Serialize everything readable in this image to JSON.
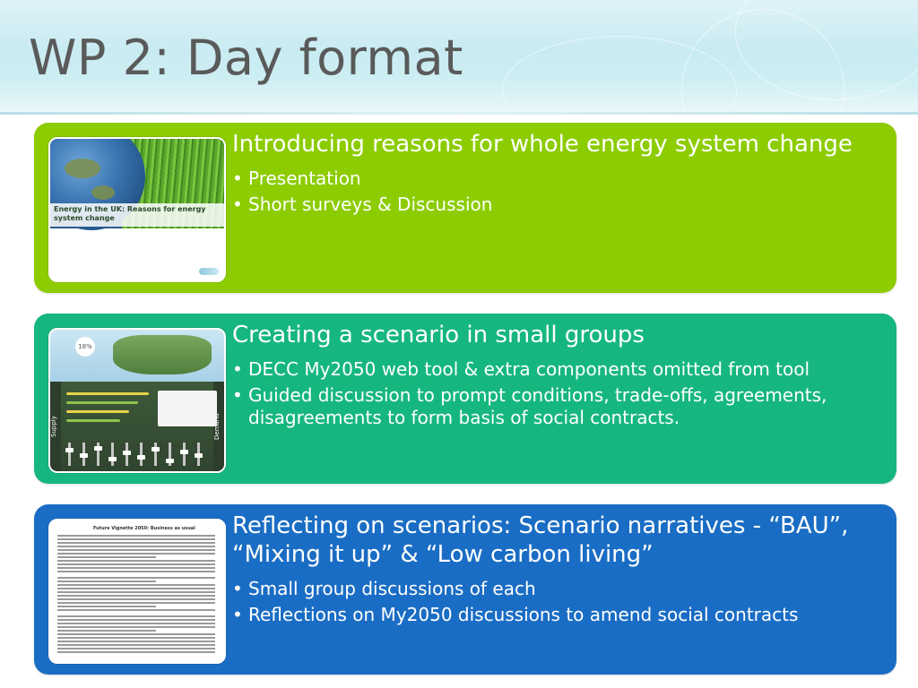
{
  "slide": {
    "title": "WP 2: Day format"
  },
  "panels": [
    {
      "heading": "Introducing reasons for whole energy system change",
      "bullets": [
        "Presentation",
        "Short surveys & Discussion"
      ],
      "thumbnail": {
        "caption": "Energy in the UK: Reasons for energy system change"
      },
      "color": "#8ccc00"
    },
    {
      "heading": "Creating a scenario in small groups",
      "bullets": [
        "DECC My2050 web tool & extra components omitted from tool",
        "Guided discussion to prompt conditions, trade-offs, agreements, disagreements to form basis of social contracts."
      ],
      "thumbnail": {
        "badge": "18%",
        "left_label": "Supply",
        "right_label": "Demand"
      },
      "color": "#16b77e"
    },
    {
      "heading": "Reflecting on scenarios: Scenario narratives - “BAU”, “Mixing it up” & “Low carbon living”",
      "bullets": [
        "Small group discussions of each",
        "Reflections on My2050 discussions to amend social contracts"
      ],
      "thumbnail": {
        "doc_title": "Future Vignette 2050: Business as usual"
      },
      "color": "#1a6dc4"
    }
  ],
  "bullet_glyph": "•"
}
